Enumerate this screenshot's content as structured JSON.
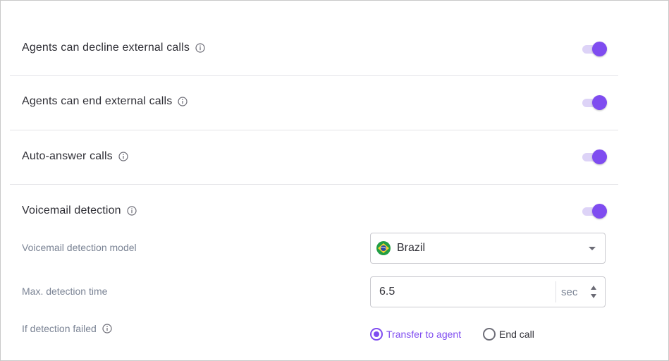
{
  "settings": [
    {
      "label": "Agents can decline external calls",
      "enabled": true
    },
    {
      "label": "Agents can end external calls",
      "enabled": true
    },
    {
      "label": "Auto-answer calls",
      "enabled": true
    },
    {
      "label": "Voicemail detection",
      "enabled": true
    }
  ],
  "voicemail": {
    "model_label": "Voicemail detection model",
    "model_value": "Brazil",
    "model_flag_icon": "brazil-flag-icon",
    "max_time_label": "Max. detection time",
    "max_time_value": "6.5",
    "max_time_unit": "sec",
    "failed_label": "If detection failed",
    "options": [
      {
        "label": "Transfer to agent",
        "selected": true
      },
      {
        "label": "End call",
        "selected": false
      }
    ]
  },
  "colors": {
    "accent": "#7f4cf0",
    "toggle_track": "#ddd3f7",
    "text_primary": "#2f2f36",
    "text_secondary": "#7a8394",
    "divider": "#e4e4e8"
  },
  "icons": {
    "info": "info-circle-icon",
    "dropdown": "caret-down-icon",
    "spinner": "spinner-arrows-icon"
  }
}
